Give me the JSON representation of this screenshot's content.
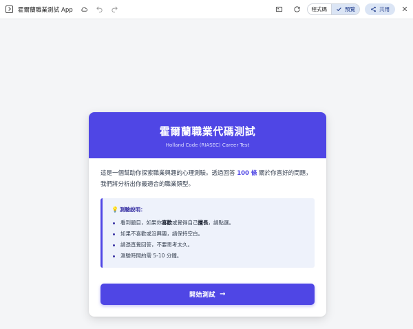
{
  "toolbar": {
    "app_title": "霍爾蘭職業測試 App",
    "icons": [
      "app-icon",
      "cloud-icon",
      "undo-icon",
      "redo-icon",
      "layout-icon",
      "refresh-icon",
      "share-icon",
      "close-icon"
    ],
    "code_label": "程式碼",
    "preview_label": "預覽",
    "share_label": "共用",
    "close_glyph": "✕"
  },
  "card": {
    "title": "霍爾蘭職業代碼測試",
    "subtitle": "Holland Code (RIASEC) Career Test",
    "intro_before": "這是一個幫助你探索職業興趣的心理測驗。透過回答 ",
    "intro_highlight": "100 條",
    "intro_after": " 關於你喜好的問題，我們將分析出你最適合的職業類型。",
    "info_icon": "💡",
    "info_title": "測驗說明：",
    "info_items": [
      {
        "parts": [
          "看到題目，如果你",
          "喜歡",
          "或覺得自己",
          "擅長",
          "，請點選。"
        ]
      },
      {
        "text": "如果不喜歡或沒興趣，請保持空白。"
      },
      {
        "text": "請憑直覺回答，不要思考太久。"
      },
      {
        "text": "測驗時間約需 5-10 分鐘。"
      }
    ],
    "start_label": "開始測試",
    "start_arrow": "→"
  },
  "colors": {
    "accent": "#4f46e5",
    "info_bg": "#eef2fb",
    "page_bg": "#f4f5f7"
  }
}
